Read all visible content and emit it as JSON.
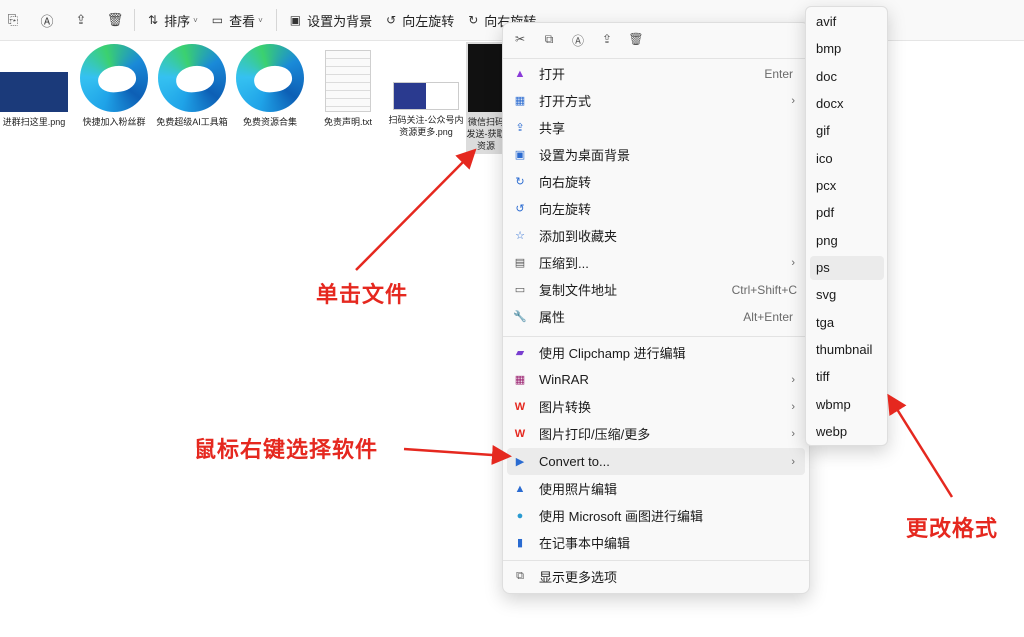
{
  "toolbar": {
    "items": [
      {
        "icon": "copy-icon"
      },
      {
        "icon": "rename-icon"
      },
      {
        "icon": "share-icon"
      },
      {
        "icon": "delete-icon"
      }
    ],
    "sort_label": "排序",
    "view_label": "查看",
    "set_background_label": "设置为背景",
    "rotate_left_label": "向左旋转",
    "rotate_right_label": "向右旋转"
  },
  "files": [
    {
      "name": "进群扫这里.png",
      "kind": "image"
    },
    {
      "name": "快捷加入粉丝群",
      "kind": "edge-shortcut"
    },
    {
      "name": "免费超级AI工具箱",
      "kind": "edge-shortcut"
    },
    {
      "name": "免费资源合集",
      "kind": "edge-shortcut"
    },
    {
      "name": "免责声明.txt",
      "kind": "text"
    },
    {
      "name": "扫码关注-公众号内资源更多.png",
      "kind": "image"
    },
    {
      "name": "微信扫码发送-获取资源",
      "kind": "image-selected"
    }
  ],
  "context_menu": {
    "quick_actions": [
      "cut-icon",
      "copy-icon",
      "rename-icon",
      "share-icon",
      "delete-icon"
    ],
    "items": [
      {
        "label": "打开",
        "shortcut": "Enter",
        "icon": "open-icon",
        "submenu": false
      },
      {
        "label": "打开方式",
        "shortcut": "",
        "icon": "open-with-icon",
        "submenu": true
      },
      {
        "label": "共享",
        "shortcut": "",
        "icon": "share-icon",
        "submenu": false
      },
      {
        "label": "设置为桌面背景",
        "shortcut": "",
        "icon": "wallpaper-icon",
        "submenu": false
      },
      {
        "label": "向右旋转",
        "shortcut": "",
        "icon": "rotate-right-icon",
        "submenu": false
      },
      {
        "label": "向左旋转",
        "shortcut": "",
        "icon": "rotate-left-icon",
        "submenu": false
      },
      {
        "label": "添加到收藏夹",
        "shortcut": "",
        "icon": "star-icon",
        "submenu": false
      },
      {
        "label": "压缩到...",
        "shortcut": "",
        "icon": "zip-icon",
        "submenu": true
      },
      {
        "label": "复制文件地址",
        "shortcut": "Ctrl+Shift+C",
        "icon": "copy-path-icon",
        "submenu": false
      },
      {
        "label": "属性",
        "shortcut": "Alt+Enter",
        "icon": "wrench-icon",
        "submenu": false
      },
      {
        "label": "使用 Clipchamp 进行编辑",
        "shortcut": "",
        "icon": "clipchamp-icon",
        "submenu": false
      },
      {
        "label": "WinRAR",
        "shortcut": "",
        "icon": "winrar-icon",
        "submenu": true
      },
      {
        "label": "图片转换",
        "shortcut": "",
        "icon": "wps-icon",
        "submenu": true
      },
      {
        "label": "图片打印/压缩/更多",
        "shortcut": "",
        "icon": "wps-icon",
        "submenu": true
      },
      {
        "label": "Convert to...",
        "shortcut": "",
        "icon": "convert-icon",
        "submenu": true
      },
      {
        "label": "使用照片编辑",
        "shortcut": "",
        "icon": "photos-icon",
        "submenu": false
      },
      {
        "label": "使用 Microsoft 画图进行编辑",
        "shortcut": "",
        "icon": "paint-icon",
        "submenu": false
      },
      {
        "label": "在记事本中编辑",
        "shortcut": "",
        "icon": "notepad-icon",
        "submenu": false
      },
      {
        "label": "显示更多选项",
        "shortcut": "",
        "icon": "more-options-icon",
        "submenu": false
      }
    ]
  },
  "convert_submenu": [
    "avif",
    "bmp",
    "doc",
    "docx",
    "gif",
    "ico",
    "pcx",
    "pdf",
    "png",
    "ps",
    "svg",
    "tga",
    "thumbnail",
    "tiff",
    "wbmp",
    "webp"
  ],
  "annotations": {
    "click_file": "单击文件",
    "right_click": "鼠标右键选择软件",
    "change_format": "更改格式"
  },
  "colors": {
    "annotation": "#e5281f",
    "menu_bg": "#f9f9f9",
    "highlight": "#ebebeb"
  }
}
